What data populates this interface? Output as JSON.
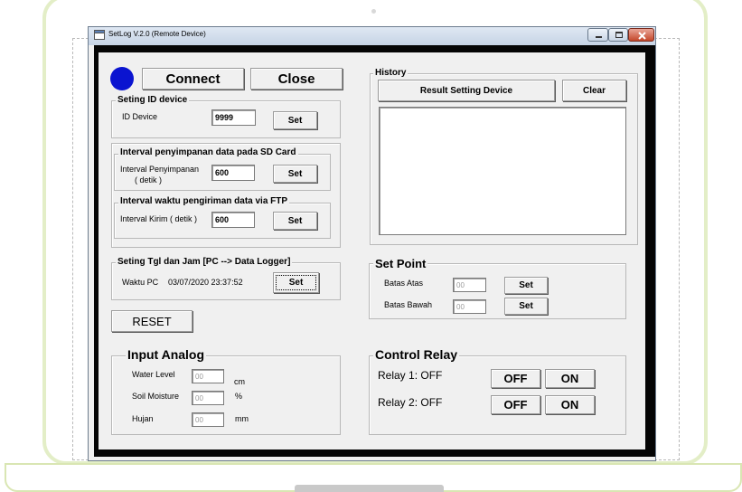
{
  "window": {
    "title": "SetLog V.2.0 (Remote Device)"
  },
  "toolbar": {
    "connect_label": "Connect",
    "close_label": "Close",
    "status_color": "#0a14d0"
  },
  "id_device": {
    "group_title": "Seting ID device",
    "label": "ID Device",
    "value": "9999",
    "set_label": "Set"
  },
  "interval_sd": {
    "group_title": "Interval penyimpanan data pada SD Card",
    "label_line1": "Interval Penyimpanan",
    "label_line2": "( detik )",
    "value": "600",
    "set_label": "Set"
  },
  "interval_ftp": {
    "group_title": "Interval waktu pengiriman data via FTP",
    "label": "Interval Kirim ( detik )",
    "value": "600",
    "set_label": "Set"
  },
  "datetime": {
    "group_title": "Seting Tgl dan Jam [PC --> Data Logger]",
    "label": "Waktu PC",
    "value": "03/07/2020 23:37:52",
    "set_label": "Set"
  },
  "reset_label": "RESET",
  "history": {
    "group_title": "History",
    "result_label": "Result Setting Device",
    "clear_label": "Clear",
    "log": ""
  },
  "set_point": {
    "group_title": "Set Point",
    "upper_label": "Batas Atas",
    "upper_value": "00",
    "lower_label": "Batas Bawah",
    "lower_value": "00",
    "set_label": "Set"
  },
  "input_analog": {
    "group_title": "Input Analog",
    "water_label": "Water Level",
    "water_value": "00",
    "water_unit": "cm",
    "soil_label": "Soil Moisture",
    "soil_value": "00",
    "soil_unit": "%",
    "rain_label": "Hujan",
    "rain_value": "00",
    "rain_unit": "mm"
  },
  "control_relay": {
    "group_title": "Control Relay",
    "relay1_status": "Relay 1: OFF",
    "relay2_status": "Relay 2: OFF",
    "off_label": "OFF",
    "on_label": "ON"
  }
}
